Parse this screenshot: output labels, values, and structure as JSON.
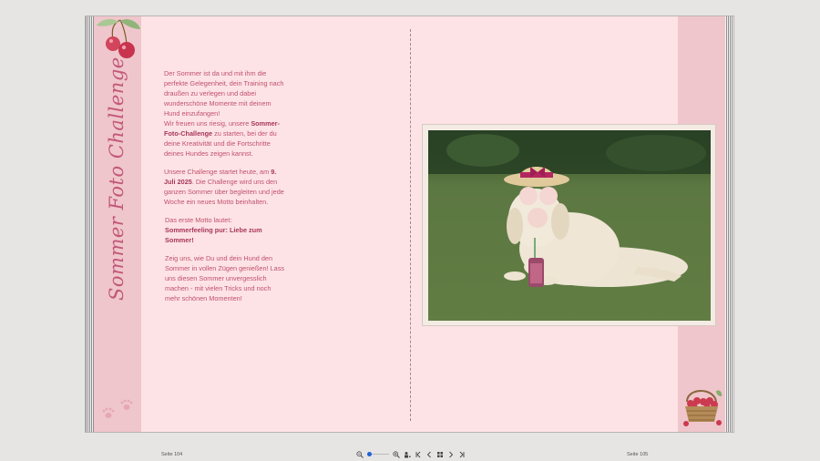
{
  "book": {
    "vertical_title": "Sommer Foto Challenge",
    "paragraphs": {
      "p1": "Der Sommer ist da und mit ihm die perfekte Gelegenheit, dein Training nach draußen zu verlegen und dabei wunderschöne Momente mit deinem Hund einzufangen!",
      "p2_a": "Wir freuen uns riesig, unsere ",
      "p2_b": "Sommer-Foto-Challenge",
      "p2_c": " zu starten, bei der du deine Kreativität und die Fortschritte deines Hundes zeigen kannst.",
      "p3_a": "Unsere Challenge startet heute, am ",
      "p3_b": "9. Juli 2025",
      "p3_c": ". Die Challenge wird uns den ganzen Sommer über begleiten und jede Woche ein neues Motto beinhalten.",
      "p4_a": "Das erste Motto lautet:",
      "p4_b": "Sommerfeeling pur: Liebe zum Sommer!",
      "p5": "Zeig uns, wie Du und dein Hund den Sommer in vollen Zügen genießen! Lass uns diesen Sommer unvergesslich machen - mit vielen Tricks und noch mehr schönen Momenten!"
    }
  },
  "footer": {
    "page_left": "Seite 104",
    "page_right": "Seite 105",
    "zoom_level": 0.1
  },
  "icons": [
    "cherries-icon",
    "paw-prints-icon",
    "cherry-basket-icon",
    "zoom-out-icon",
    "zoom-in-icon",
    "fit-page-icon",
    "first-page-icon",
    "prev-page-icon",
    "grid-view-icon",
    "next-page-icon",
    "last-page-icon"
  ],
  "colors": {
    "page": "#fde3e5",
    "strip": "#efc6cb",
    "accent": "#c2587a",
    "slider": "#1e63d6"
  }
}
